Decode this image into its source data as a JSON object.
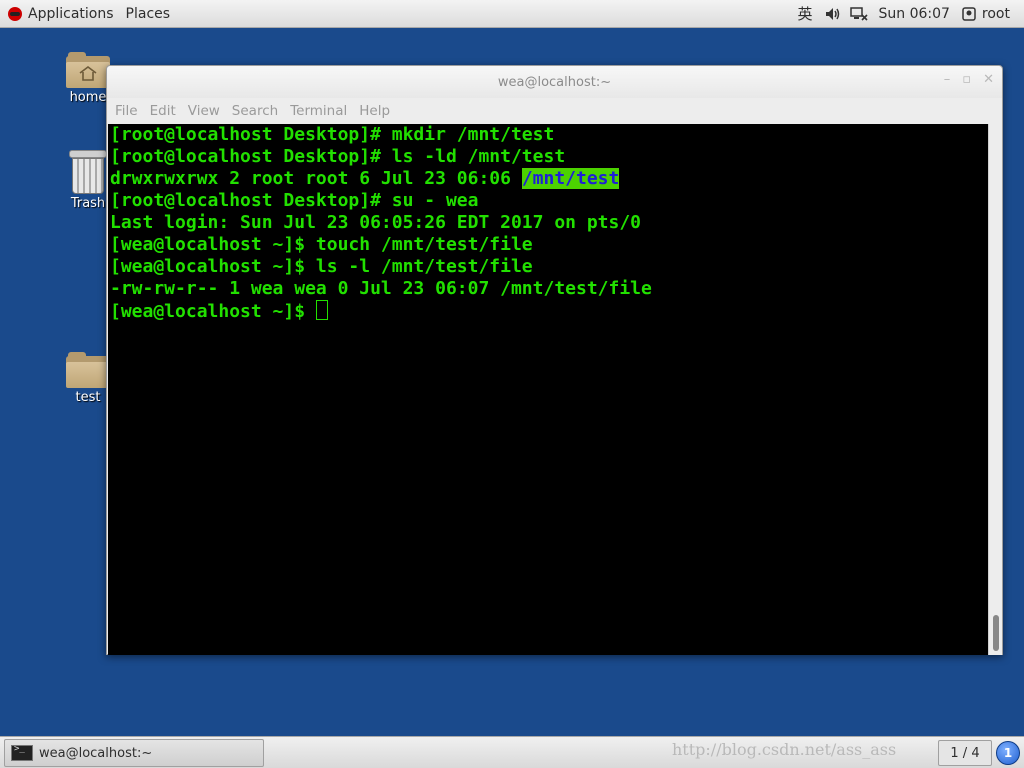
{
  "topbar": {
    "applications": "Applications",
    "places": "Places",
    "ime": "英",
    "clock": "Sun 06:07",
    "user": "root"
  },
  "desktop": {
    "icons": [
      {
        "label": "home",
        "icon": "home-folder-icon"
      },
      {
        "label": "Trash",
        "icon": "trash-icon"
      },
      {
        "label": "test",
        "icon": "folder-icon"
      }
    ]
  },
  "window": {
    "title": "wea@localhost:~",
    "minimize": "–",
    "maximize": "▫",
    "close": "✕",
    "menu": [
      "File",
      "Edit",
      "View",
      "Search",
      "Terminal",
      "Help"
    ]
  },
  "terminal": {
    "lines": [
      "[root@localhost Desktop]# mkdir /mnt/test",
      "[root@localhost Desktop]# ls -ld /mnt/test",
      "drwxrwxrwx 2 root root 6 Jul 23 06:06 ",
      "[root@localhost Desktop]# su - wea",
      "Last login: Sun Jul 23 06:05:26 EDT 2017 on pts/0",
      "[wea@localhost ~]$ touch /mnt/test/file",
      "[wea@localhost ~]$ ls -l /mnt/test/file",
      "-rw-rw-r-- 1 wea wea 0 Jul 23 06:07 /mnt/test/file",
      "[wea@localhost ~]$ "
    ],
    "highlighted_path": "/mnt/test",
    "colors": {
      "text": "#22e000",
      "background": "#000000",
      "highlight_bg": "#4cd200",
      "highlight_fg": "#1f1fd6"
    }
  },
  "taskbar": {
    "window_button": "wea@localhost:~",
    "watermark": "http://blog.csdn.net/ass_ass",
    "pager": "1 / 4",
    "notifications": "1"
  }
}
